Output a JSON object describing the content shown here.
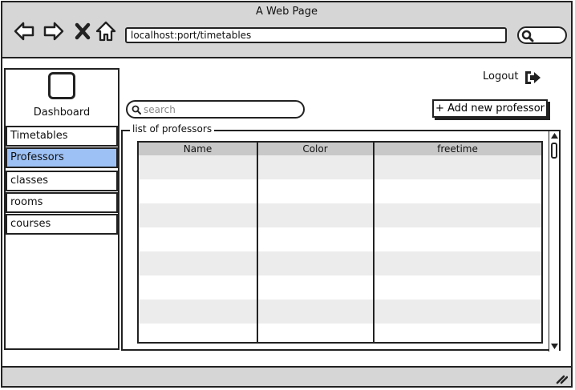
{
  "window": {
    "title": "A Web Page"
  },
  "browser": {
    "url": "localhost:port/timetables",
    "back_icon": "arrow-left-icon",
    "forward_icon": "arrow-right-icon",
    "stop_icon": "close-icon",
    "home_icon": "home-icon"
  },
  "sidebar": {
    "dashboard_label": "Dashboard",
    "items": [
      {
        "label": "Timetables",
        "active": false
      },
      {
        "label": "Professors",
        "active": true
      },
      {
        "label": "classes",
        "active": false
      },
      {
        "label": "rooms",
        "active": false
      },
      {
        "label": "courses",
        "active": false
      }
    ]
  },
  "header": {
    "logout_label": "Logout"
  },
  "search": {
    "placeholder": "search",
    "value": ""
  },
  "toolbar": {
    "add_label": "+ Add new professor"
  },
  "professors": {
    "group_label": "list of professors",
    "columns": [
      "Name",
      "Color",
      "freetime"
    ],
    "rows": []
  },
  "colors": {
    "active_item": "#9dc1f5",
    "chrome": "#d6d6d6",
    "row_shade": "#ececec"
  }
}
